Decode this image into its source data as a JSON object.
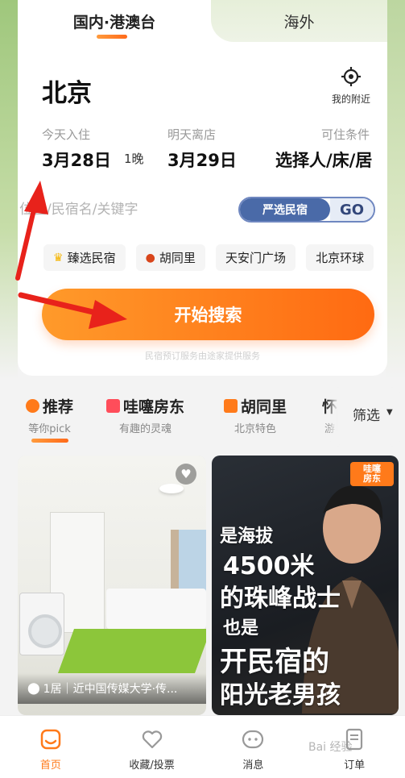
{
  "tabs": {
    "domestic": "国内·港澳台",
    "overseas": "海外"
  },
  "location": {
    "city": "北京",
    "nearby_label": "我的附近"
  },
  "dates": {
    "checkin_label": "今天入住",
    "checkin_value": "3月28日",
    "nights": "1晚",
    "checkout_label": "明天离店",
    "checkout_value": "3月29日",
    "condition_label": "可住条件",
    "condition_value": "选择人/床/居"
  },
  "search": {
    "placeholder": "位置/民宿名/关键字",
    "promo_label": "严选民宿",
    "go_label": "GO"
  },
  "chips": [
    {
      "icon": "crown-icon",
      "label": "臻选民宿"
    },
    {
      "icon": "lantern-icon",
      "label": "胡同里"
    },
    {
      "label": "天安门广场"
    },
    {
      "label": "北京环球"
    }
  ],
  "start_button": "开始搜索",
  "notice": "民宿预订服务由途家提供服务",
  "categories": [
    {
      "title": "推荐",
      "sub": "等你pick"
    },
    {
      "title": "哇噻房东",
      "sub": "有趣的灵魂"
    },
    {
      "title": "胡同里",
      "sub": "北京特色"
    },
    {
      "title": "怀",
      "sub": "游"
    }
  ],
  "filter_label": "筛选",
  "listing": {
    "caption": "1居｜近中国传媒大学·传..."
  },
  "promo": {
    "badge_top": "哇噻",
    "badge_bottom": "房东",
    "lines": [
      "是海拔",
      "4500米",
      "的珠峰战士",
      "也是",
      "开民宿的",
      "阳光老男孩"
    ]
  },
  "nav": [
    {
      "label": "首页",
      "icon": "home-icon"
    },
    {
      "label": "收藏/投票",
      "icon": "heart-icon"
    },
    {
      "label": "消息",
      "icon": "message-icon"
    },
    {
      "label": "订单",
      "icon": "order-icon"
    }
  ],
  "watermark": "Bai 经验",
  "colors": {
    "accent": "#ff7a1a",
    "go_blue": "#4a6aa8",
    "annotation_red": "#e8221b"
  }
}
